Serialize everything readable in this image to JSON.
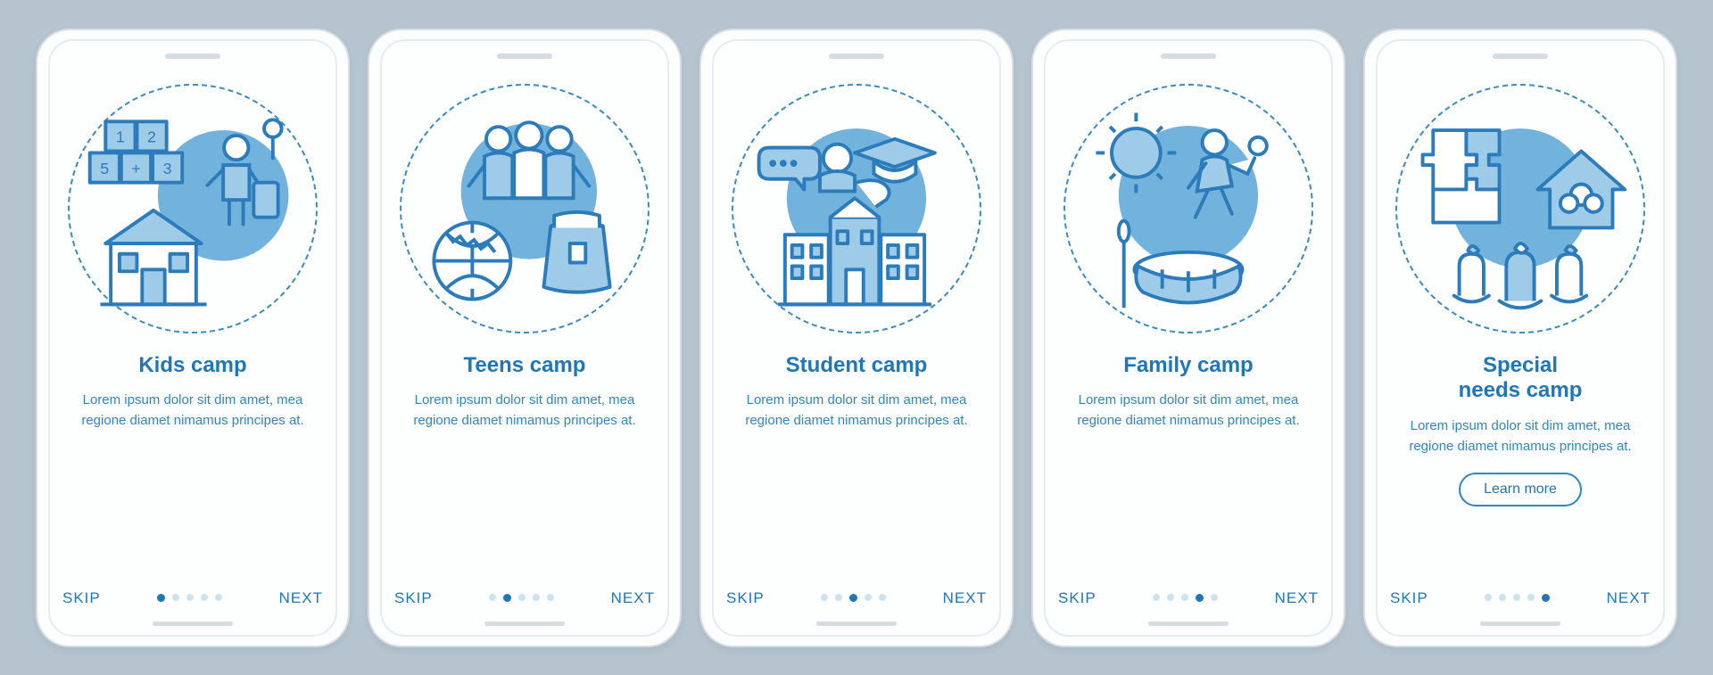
{
  "colors": {
    "stroke": "#2c7bbb",
    "fill": "#9dcbe8",
    "accent": "#71b3dc",
    "bg": "#fdfefe"
  },
  "screens": [
    {
      "title": "Kids camp",
      "desc": "Lorem ipsum dolor sit dim amet, mea regione diamet nimamus principes at.",
      "skip": "SKIP",
      "next": "NEXT",
      "activeDot": 0,
      "cta": null,
      "icon": "kids"
    },
    {
      "title": "Teens camp",
      "desc": "Lorem ipsum dolor sit dim amet, mea regione diamet nimamus principes at.",
      "skip": "SKIP",
      "next": "NEXT",
      "activeDot": 1,
      "cta": null,
      "icon": "teens"
    },
    {
      "title": "Student camp",
      "desc": "Lorem ipsum dolor sit dim amet, mea regione diamet nimamus principes at.",
      "skip": "SKIP",
      "next": "NEXT",
      "activeDot": 2,
      "cta": null,
      "icon": "student"
    },
    {
      "title": "Family camp",
      "desc": "Lorem ipsum dolor sit dim amet, mea regione diamet nimamus principes at.",
      "skip": "SKIP",
      "next": "NEXT",
      "activeDot": 3,
      "cta": null,
      "icon": "family"
    },
    {
      "title": "Special\nneeds camp",
      "desc": "Lorem ipsum dolor sit dim amet, mea regione diamet nimamus principes at.",
      "skip": "SKIP",
      "next": "NEXT",
      "activeDot": 4,
      "cta": "Learn more",
      "icon": "special"
    }
  ],
  "dotCount": 5
}
